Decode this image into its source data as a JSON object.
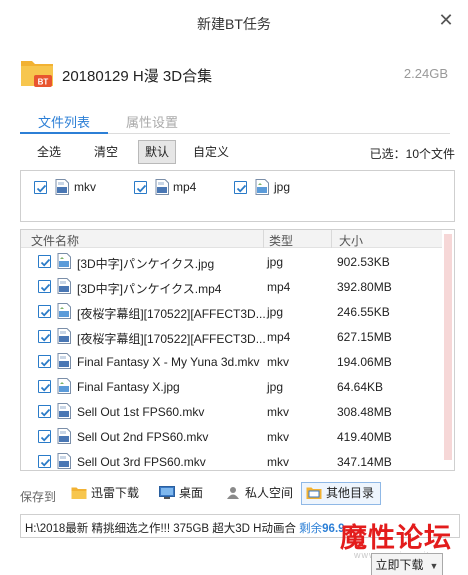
{
  "window": {
    "title": "新建BT任务",
    "close_glyph": "✕"
  },
  "task": {
    "name": "20180129 H漫 3D合集",
    "size": "2.24GB",
    "folder_badge": "BT"
  },
  "tabs": [
    {
      "label": "文件列表",
      "active": true
    },
    {
      "label": "属性设置",
      "active": false
    }
  ],
  "filter": {
    "buttons": [
      "全选",
      "清空",
      "默认",
      "自定义"
    ],
    "active": "默认",
    "selected_text": "已选：10个文件"
  },
  "types": [
    {
      "label": "mkv",
      "checked": true,
      "icon": "video-file-icon"
    },
    {
      "label": "mp4",
      "checked": true,
      "icon": "video-file-icon"
    },
    {
      "label": "jpg",
      "checked": true,
      "icon": "image-file-icon"
    }
  ],
  "table": {
    "headers": {
      "name": "文件名称",
      "type": "类型",
      "size": "大小"
    },
    "rows": [
      {
        "name": "[3D中字]パンケイクス.jpg",
        "type": "jpg",
        "size": "902.53KB",
        "checked": true,
        "icon": "image-file-icon"
      },
      {
        "name": "[3D中字]パンケイクス.mp4",
        "type": "mp4",
        "size": "392.80MB",
        "checked": true,
        "icon": "video-file-icon"
      },
      {
        "name": "[夜桜字幕组][170522][AFFECT3D...",
        "type": "jpg",
        "size": "246.55KB",
        "checked": true,
        "icon": "image-file-icon"
      },
      {
        "name": "[夜桜字幕组][170522][AFFECT3D...",
        "type": "mp4",
        "size": "627.15MB",
        "checked": true,
        "icon": "video-file-icon"
      },
      {
        "name": "Final Fantasy X - My Yuna 3d.mkv",
        "type": "mkv",
        "size": "194.06MB",
        "checked": true,
        "icon": "video-file-icon"
      },
      {
        "name": "Final Fantasy X.jpg",
        "type": "jpg",
        "size": "64.64KB",
        "checked": true,
        "icon": "image-file-icon"
      },
      {
        "name": "Sell Out 1st FPS60.mkv",
        "type": "mkv",
        "size": "308.48MB",
        "checked": true,
        "icon": "video-file-icon"
      },
      {
        "name": "Sell Out 2nd FPS60.mkv",
        "type": "mkv",
        "size": "419.40MB",
        "checked": true,
        "icon": "video-file-icon"
      },
      {
        "name": "Sell Out 3rd FPS60.mkv",
        "type": "mkv",
        "size": "347.14MB",
        "checked": true,
        "icon": "video-file-icon"
      }
    ]
  },
  "save": {
    "label": "保存到",
    "options": [
      {
        "label": "迅雷下载",
        "icon": "folder-icon",
        "active": false
      },
      {
        "label": "桌面",
        "icon": "desktop-icon",
        "active": false
      },
      {
        "label": "私人空间",
        "icon": "private-space-icon",
        "active": false
      },
      {
        "label": "其他目录",
        "icon": "folder-open-icon",
        "active": true
      }
    ],
    "path": "H:\\2018最新 精挑细选之作!!! 375GB  超大3D H动画合",
    "remain_label": "剩余",
    "remain_value": "96.9"
  },
  "start_button": {
    "label": "立即下载",
    "caret": "▼"
  },
  "watermark": {
    "text": "魔性论坛",
    "url": "www.moxing.city"
  },
  "colors": {
    "accent": "#2c7fd6",
    "checkbox": "#2a7bc8",
    "watermark": "#e31c1c",
    "folder": "#f2b233",
    "badge": "#e8552f"
  }
}
